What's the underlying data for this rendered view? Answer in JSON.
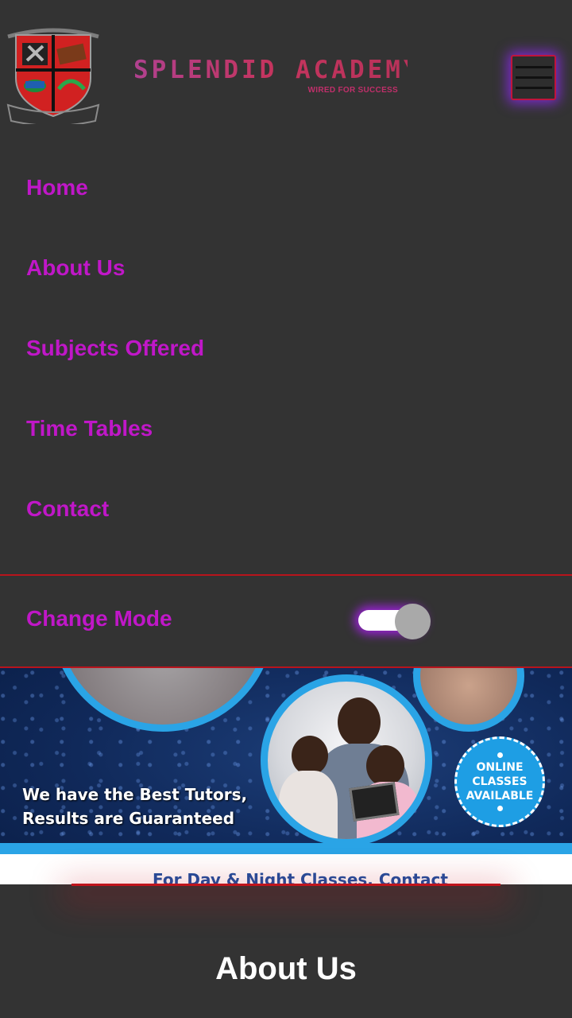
{
  "brand": {
    "name": "SPLENDID ACADEMY",
    "tagline": "WIRED FOR SUCCESS"
  },
  "nav": {
    "items": [
      {
        "label": "Home"
      },
      {
        "label": "About Us"
      },
      {
        "label": "Subjects Offered"
      },
      {
        "label": "Time Tables"
      },
      {
        "label": "Contact"
      }
    ],
    "mode_label": "Change Mode",
    "mode_toggle_on": true
  },
  "banner": {
    "headline_line1": "We have the Best Tutors,",
    "headline_line2": "Results are Guaranteed",
    "badge_line1": "ONLINE",
    "badge_line2": "CLASSES",
    "badge_line3": "AVAILABLE",
    "footer_text": "For Day & Night Classes, Contact"
  },
  "section": {
    "title": "About Us"
  },
  "colors": {
    "background": "#333333",
    "nav_text": "#c017c8",
    "accent_red": "#c0141c",
    "glow_purple": "#a01ef0",
    "banner_blue": "#2aa4e6"
  }
}
